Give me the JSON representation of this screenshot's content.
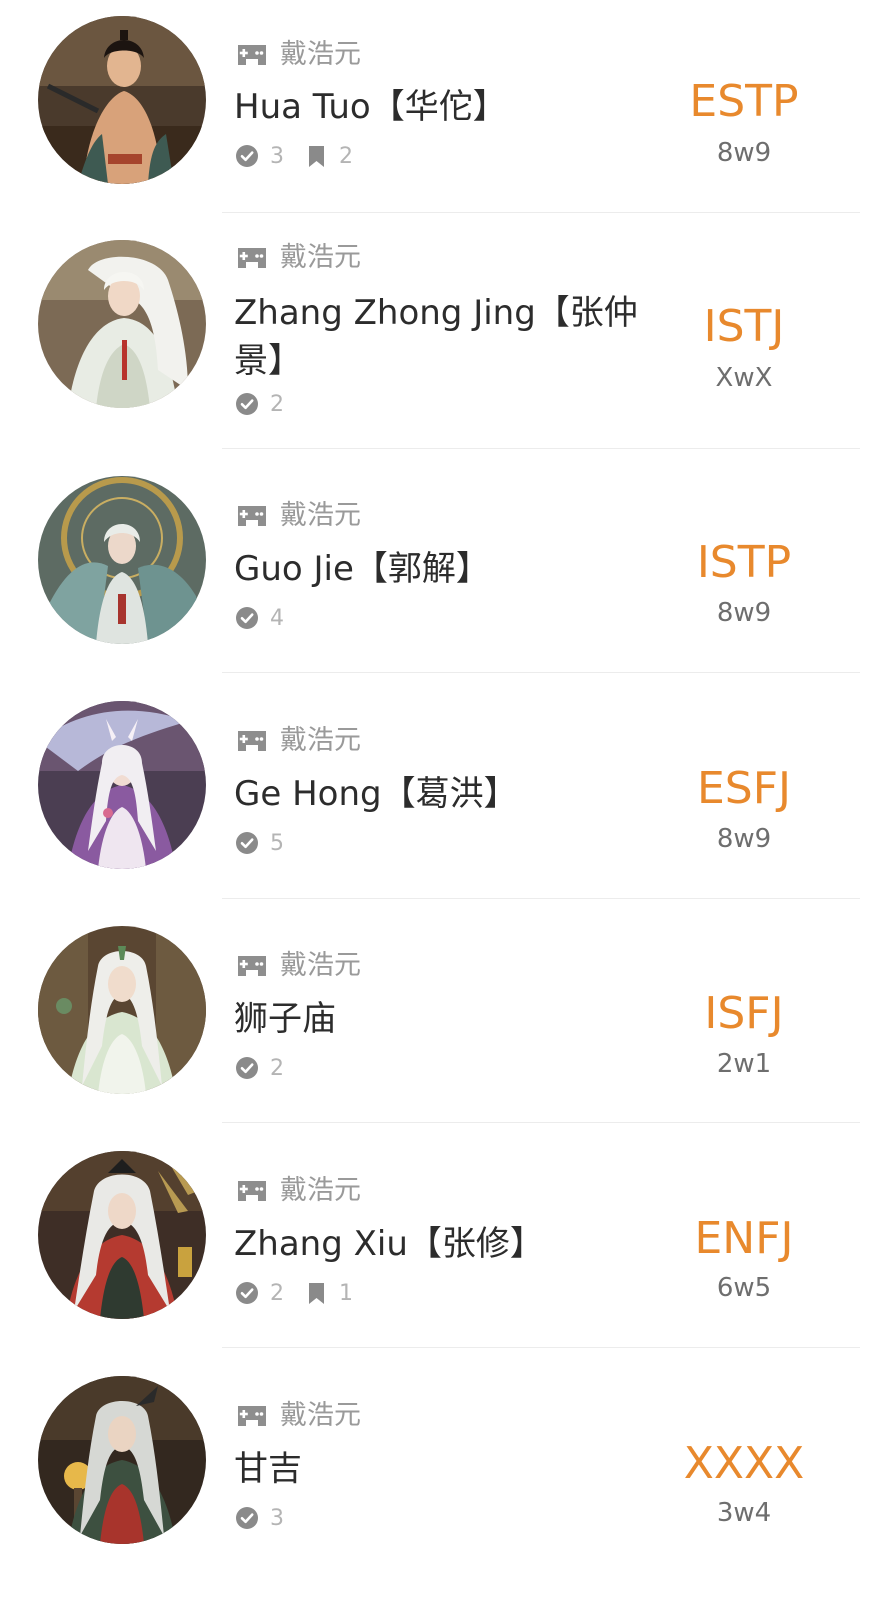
{
  "colors": {
    "accent": "#e8892d",
    "text_primary": "#2c2c2c",
    "text_secondary": "#9a9a9a",
    "divider": "#ececec"
  },
  "items": [
    {
      "avatar": "avatar-hua-tuo",
      "source": "戴浩元",
      "source_icon": "gamepad-icon",
      "name": "Hua Tuo【华佗】",
      "votes": "3",
      "bookmarks": "2",
      "mbti": "ESTP",
      "enneagram": "8w9"
    },
    {
      "avatar": "avatar-zhang-zhong-jing",
      "source": "戴浩元",
      "source_icon": "gamepad-icon",
      "name": "Zhang Zhong Jing【张仲景】",
      "votes": "2",
      "mbti": "ISTJ",
      "enneagram": "XwX"
    },
    {
      "avatar": "avatar-guo-jie",
      "source": "戴浩元",
      "source_icon": "gamepad-icon",
      "name": "Guo Jie【郭解】",
      "votes": "4",
      "mbti": "ISTP",
      "enneagram": "8w9"
    },
    {
      "avatar": "avatar-ge-hong",
      "source": "戴浩元",
      "source_icon": "gamepad-icon",
      "name": "Ge Hong【葛洪】",
      "votes": "5",
      "mbti": "ESFJ",
      "enneagram": "8w9"
    },
    {
      "avatar": "avatar-shi-zi-miao",
      "source": "戴浩元",
      "source_icon": "gamepad-icon",
      "name": "狮子庙",
      "votes": "2",
      "mbti": "ISFJ",
      "enneagram": "2w1"
    },
    {
      "avatar": "avatar-zhang-xiu",
      "source": "戴浩元",
      "source_icon": "gamepad-icon",
      "name": "Zhang Xiu【张修】",
      "votes": "2",
      "bookmarks": "1",
      "mbti": "ENFJ",
      "enneagram": "6w5"
    },
    {
      "avatar": "avatar-gan-ji",
      "source": "戴浩元",
      "source_icon": "gamepad-icon",
      "name": "甘吉",
      "votes": "3",
      "mbti": "XXXX",
      "enneagram": "3w4"
    }
  ]
}
